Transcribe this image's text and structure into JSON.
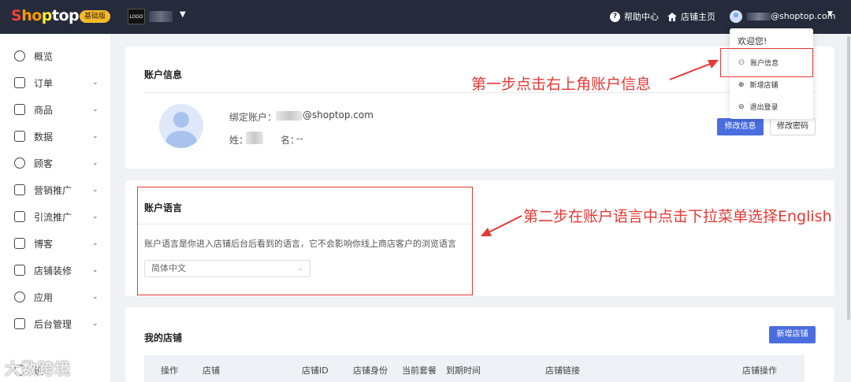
{
  "topbar": {
    "logo": [
      "S",
      "ho",
      "p",
      "top"
    ],
    "plan_badge": "基础版",
    "store_logo": "LOGO",
    "help_label": "帮助中心",
    "store_home_label": "店铺主页",
    "email": "@shoptop.com"
  },
  "dropdown": {
    "welcome": "欢迎您!",
    "items": [
      {
        "label": "账户信息",
        "icon": "user-icon"
      },
      {
        "label": "新增店铺",
        "icon": "plus-circle-icon"
      },
      {
        "label": "退出登录",
        "icon": "logout-icon"
      }
    ]
  },
  "sidebar": {
    "items": [
      {
        "label": "概览",
        "icon": "compass-icon",
        "expandable": false
      },
      {
        "label": "订单",
        "icon": "order-icon",
        "expandable": true
      },
      {
        "label": "商品",
        "icon": "product-icon",
        "expandable": true
      },
      {
        "label": "数据",
        "icon": "chart-icon",
        "expandable": true
      },
      {
        "label": "顾客",
        "icon": "customer-icon",
        "expandable": true
      },
      {
        "label": "营销推广",
        "icon": "marketing-icon",
        "expandable": true
      },
      {
        "label": "引流推广",
        "icon": "traffic-icon",
        "expandable": true
      },
      {
        "label": "博客",
        "icon": "blog-icon",
        "expandable": true
      },
      {
        "label": "店铺装修",
        "icon": "decoration-icon",
        "expandable": true
      },
      {
        "label": "应用",
        "icon": "apps-icon",
        "expandable": true
      },
      {
        "label": "后台管理",
        "icon": "admin-icon",
        "expandable": true
      }
    ],
    "partial_label": "设"
  },
  "account_info": {
    "title": "账户信息",
    "bound_account_label": "绑定账户：",
    "bound_account_email": "@shoptop.com",
    "surname_label": "姓：",
    "given_name_label": "名：",
    "given_name_value": "--",
    "edit_info_button": "修改信息",
    "change_password_button": "修改密码"
  },
  "account_language": {
    "title": "账户语言",
    "description": "账户语言是你进入店铺后台后看到的语言，它不会影响你线上商店客户的浏览语言",
    "selected_language": "简体中文"
  },
  "my_stores": {
    "title": "我的店铺",
    "add_store_button": "新增店铺",
    "columns": [
      "操作",
      "店铺",
      "店铺ID",
      "店铺身份",
      "当前套餐",
      "到期时间",
      "店铺链接",
      "店铺操作"
    ]
  },
  "annotations": {
    "step1": "第一步点击右上角账户信息",
    "step2": "第二步在账户语言中点击下拉菜单选择English"
  },
  "watermark": "大数跨境",
  "colors": {
    "topbar": "#252b3b",
    "primary": "#4a6ee0",
    "annotation": "#e53935",
    "badge": "#f7b82c"
  }
}
